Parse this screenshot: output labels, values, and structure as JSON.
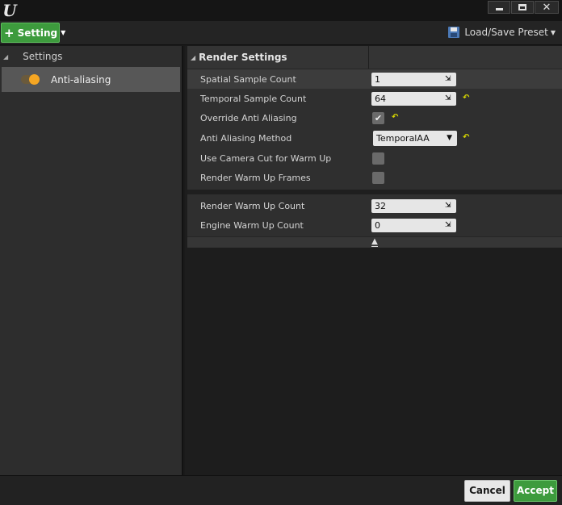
{
  "window": {
    "logo_glyph": "U",
    "controls": {
      "minimize": "minimize-icon",
      "maximize": "maximize-icon",
      "close": "close-icon"
    }
  },
  "toolbar": {
    "setting_label": "Setting",
    "preset_label": "Load/Save Preset"
  },
  "sidebar": {
    "header": "Settings",
    "items": [
      {
        "label": "Anti-aliasing",
        "enabled": true
      }
    ]
  },
  "details": {
    "category": "Render Settings",
    "rows": [
      {
        "label": "Spatial Sample Count",
        "type": "number",
        "value": "1"
      },
      {
        "label": "Temporal Sample Count",
        "type": "number",
        "value": "64",
        "reset": true
      },
      {
        "label": "Override Anti Aliasing",
        "type": "checkbox",
        "checked": true,
        "reset": true
      },
      {
        "label": "Anti Aliasing Method",
        "type": "combo",
        "value": "TemporalAA",
        "reset": true
      },
      {
        "label": "Use Camera Cut for Warm Up",
        "type": "checkbox",
        "checked": false
      },
      {
        "label": "Render Warm Up Frames",
        "type": "checkbox",
        "checked": false
      },
      {
        "label": "Render Warm Up Count",
        "type": "number",
        "value": "32"
      },
      {
        "label": "Engine Warm Up Count",
        "type": "number",
        "value": "0"
      }
    ],
    "reset_glyph": "↶",
    "drag_glyph": "⇲",
    "check_glyph": "✔"
  },
  "footer": {
    "cancel_label": "Cancel",
    "accept_label": "Accept"
  },
  "colors": {
    "accent_green": "#3d9b3d",
    "toggle_orange": "#f5a623",
    "reset_yellow": "#d6d600"
  }
}
